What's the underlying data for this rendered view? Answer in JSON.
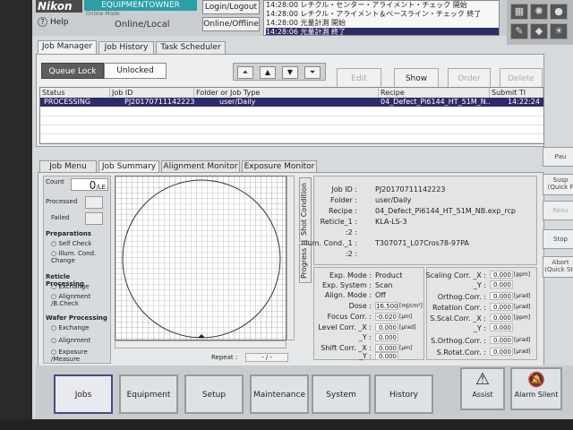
{
  "brand": "Nikon",
  "help_label": "Help",
  "user": "EQUIPMENTOWNER",
  "online_mode_label": "Online Mode",
  "online_mode_value": "Online/Local",
  "login_button": "Login/Logout",
  "offline_button": "Online/Offline",
  "messages": [
    "14:28:00 レチクル・センター・アライメント・チェック 開始",
    "14:28:00 レチクル・アライメント＆ベースライン・チェック 終了",
    "14:28:00 光量計測 開始",
    "14:28:06 光量計測 終了"
  ],
  "main_tabs": [
    "Job Manager",
    "Job History",
    "Task Scheduler"
  ],
  "queue_lock_label": "Queue Lock",
  "queue_lock_value": "Unlocked",
  "nav_icons": [
    "move-top-icon",
    "move-up-icon",
    "move-down-icon",
    "move-bottom-icon"
  ],
  "nav_glyphs": [
    "⏶",
    "▲",
    "▼",
    "⏷"
  ],
  "action_buttons": {
    "edit": "Edit",
    "show": "Show",
    "order": "Order",
    "delete": "Delete"
  },
  "job_table": {
    "headers": [
      "Status",
      "Job ID",
      "Folder or Job Type",
      "Recipe",
      "Submit TI"
    ],
    "rows": [
      {
        "status": "PROCESSING",
        "job_id": "PJ20170711142223",
        "folder": "user/Daily",
        "recipe": "04_Defect_Pi6144_HT_51M_N..",
        "submit": "14:22:24"
      }
    ]
  },
  "lower_tabs": [
    "Job Menu",
    "Job Summary",
    "Alignment Monitor",
    "Exposure Monitor"
  ],
  "count": {
    "label": "Count",
    "value": "0",
    "unit": "/LE"
  },
  "processed_label": "Processed",
  "failed_label": "Failed",
  "preparations": {
    "title": "Preparations",
    "items": [
      "Self Check",
      "Illum. Cond. Change"
    ]
  },
  "reticle_processing": {
    "title": "Reticle Processing",
    "items": [
      "Exchange",
      "Alignment /B.Check"
    ]
  },
  "wafer_processing": {
    "title": "Wafer Processing",
    "items": [
      "Exchange",
      "Alignment",
      "Exposure /Measure"
    ]
  },
  "repeat_label": "Repeat :",
  "repeat_value": "- / -",
  "vtabs": [
    "Shot Condition",
    "Progress"
  ],
  "job_info": {
    "job_id_label": "Job ID :",
    "job_id": "PJ20170711142223",
    "folder_label": "Folder :",
    "folder": "user/Daily",
    "recipe_label": "Recipe :",
    "recipe": "04_Defect_Pi6144_HT_51M_NB.exp_rcp",
    "reticle1_label": "Reticle_1 :",
    "reticle1": "KLA-LS-3",
    "reticle2_label": ":2 :",
    "reticle2": "",
    "illum1_label": "Illum. Cond._1 :",
    "illum1": "T307071_L07Cros78-97PA",
    "illum2_label": ":2 :",
    "illum2": ""
  },
  "exposure": {
    "exp_mode_label": "Exp. Mode :",
    "exp_mode": "Product",
    "exp_system_label": "Exp. System :",
    "exp_system": "Scan",
    "align_mode_label": "Align. Mode :",
    "align_mode": "Off",
    "dose_label": "Dose :",
    "dose": "16.500",
    "dose_unit": "[mJ/cm²]",
    "focus_label": "Focus Corr. :",
    "focus": "-0.020",
    "focus_unit": "[μm]",
    "level_label": "Level Corr. _X :",
    "level_x": "0.000",
    "level_y_label": "_Y :",
    "level_y": "0.000",
    "level_unit": "[μrad]",
    "shift_label": "Shift Corr. _X :",
    "shift_x": "0.000",
    "shift_y_label": "_Y :",
    "shift_y": "0.000",
    "shift_unit": "[μm]"
  },
  "correction": {
    "scaling_label": "Scaling Corr. _X :",
    "scaling_x": "0.000",
    "scaling_y_label": "_Y :",
    "scaling_y": "0.000",
    "scaling_unit": "[ppm]",
    "orthog_label": "Orthog.Corr. :",
    "orthog": "0.000",
    "orthog_unit": "[μrad]",
    "rotation_label": "Rotation Corr. :",
    "rotation": "0.000",
    "rotation_unit": "[μrad]",
    "sscal_label": "S.Scal.Corr. _X :",
    "sscal_x": "0.000",
    "sscal_y_label": "_Y :",
    "sscal_y": "0.000",
    "sscal_unit": "[ppm]",
    "sorthog_label": "S.Orthog.Corr. :",
    "sorthog": "0.000",
    "sorthog_unit": "[μrad]",
    "srotat_label": "S.Rotat.Corr. :",
    "srotat": "0.000",
    "srotat_unit": "[μrad]"
  },
  "right_buttons": [
    "Pau",
    "Susp (Quick F",
    "Resu",
    "Stop",
    "Abort (Quick Stc"
  ],
  "bottom_buttons": [
    "Jobs",
    "Equipment",
    "Setup",
    "Maintenance",
    "System",
    "History"
  ],
  "assist_label": "Assist",
  "alarm_label": "Alarm Silent"
}
